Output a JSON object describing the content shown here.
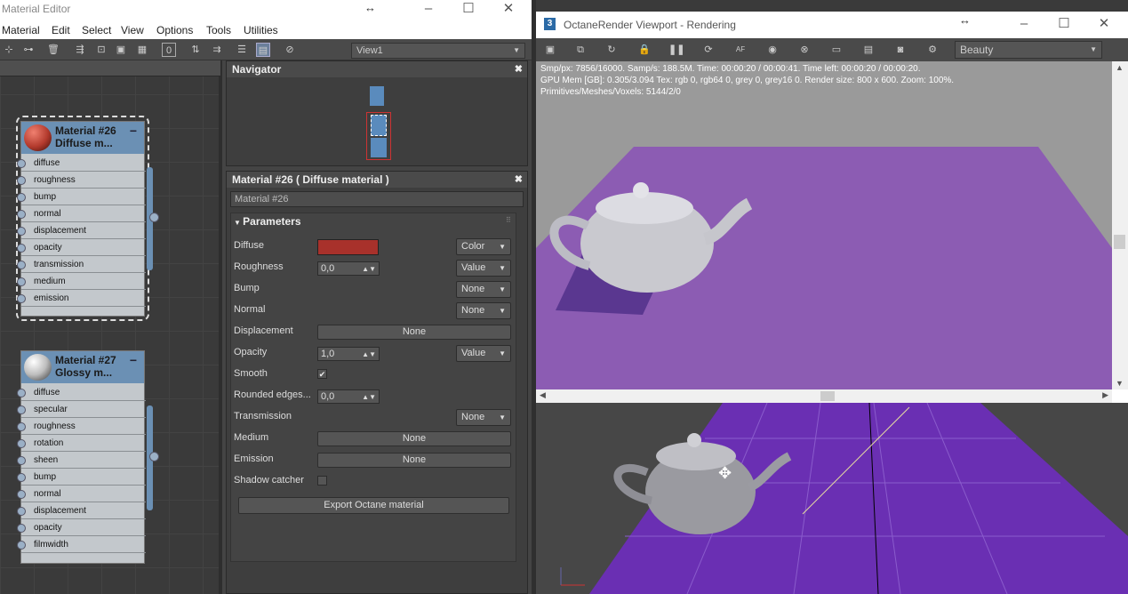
{
  "material_editor": {
    "title": "Material Editor",
    "menu": [
      "Material",
      "Edit",
      "Select",
      "View",
      "Options",
      "Tools",
      "Utilities"
    ],
    "view_select": "View1",
    "nodes": [
      {
        "name_line1": "Material #26",
        "name_line2": "Diffuse m...",
        "slots": [
          "diffuse",
          "roughness",
          "bump",
          "normal",
          "displacement",
          "opacity",
          "transmission",
          "medium",
          "emission"
        ],
        "ball_color": "#b33a2d"
      },
      {
        "name_line1": "Material #27",
        "name_line2": "Glossy m...",
        "slots": [
          "diffuse",
          "specular",
          "roughness",
          "rotation",
          "sheen",
          "bump",
          "normal",
          "displacement",
          "opacity",
          "filmwidth"
        ],
        "ball_color": "#bdbdbd"
      }
    ],
    "navigator": {
      "title": "Navigator"
    },
    "props": {
      "title": "Material #26  ( Diffuse material )",
      "name_field": "Material #26",
      "section": "Parameters",
      "diffuse_label": "Diffuse",
      "diffuse_color": "#a8312b",
      "diffuse_mode": "Color",
      "roughness_label": "Roughness",
      "roughness_value": "0,0",
      "roughness_mode": "Value",
      "bump_label": "Bump",
      "bump_mode": "None",
      "normal_label": "Normal",
      "normal_mode": "None",
      "displacement_label": "Displacement",
      "displacement_btn": "None",
      "opacity_label": "Opacity",
      "opacity_value": "1,0",
      "opacity_mode": "Value",
      "smooth_label": "Smooth",
      "smooth_check": "✔",
      "rounded_label": "Rounded edges...",
      "rounded_value": "0,0",
      "transmission_label": "Transmission",
      "transmission_mode": "None",
      "medium_label": "Medium",
      "medium_btn": "None",
      "emission_label": "Emission",
      "emission_btn": "None",
      "shadow_label": "Shadow catcher",
      "export_btn": "Export Octane material"
    }
  },
  "octane": {
    "title": "OctaneRender Viewport - Rendering",
    "pass_select": "Beauty",
    "stats_line1": "Smp/px: 7856/16000.   Samp/s: 188.5M.   Time: 00:00:20 / 00:00:41.   Time left: 00:00:20 / 00:00:20.",
    "stats_line2": "GPU Mem [GB]: 0.305/3.094   Tex: rgb 0, rgb64 0, grey 0, grey16 0.   Render size: 800 x 600.   Zoom: 100%.",
    "stats_line3": "Primitives/Meshes/Voxels: 5144/2/0",
    "floor_color": "#8c5cb3"
  }
}
